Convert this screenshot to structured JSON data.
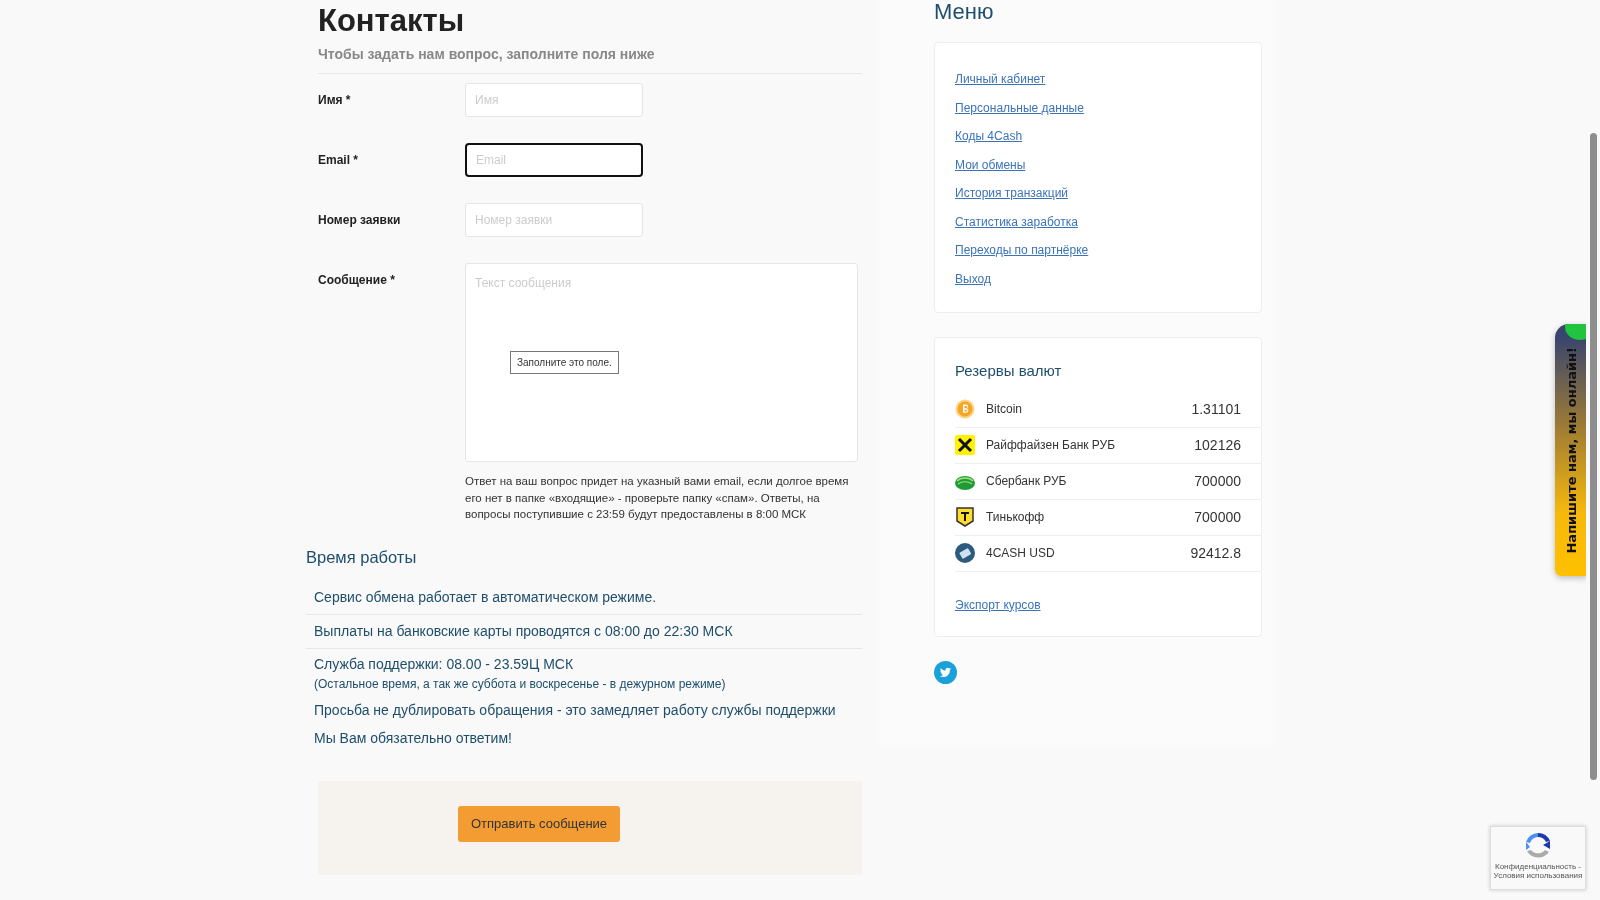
{
  "contact_form": {
    "title": "Контакты",
    "subtitle": "Чтобы задать нам вопрос, заполните поля ниже",
    "fields": [
      {
        "kind": "input",
        "label": "Имя *",
        "placeholder": "Имя",
        "focused": false
      },
      {
        "kind": "input",
        "label": "Email *",
        "placeholder": "Email",
        "focused": true
      },
      {
        "kind": "input",
        "label": "Номер заявки",
        "placeholder": "Номер заявки",
        "focused": false
      },
      {
        "kind": "textarea",
        "label": "Сообщение *",
        "placeholder": "Текст сообщения",
        "focused": false
      }
    ],
    "tooltip": "Заполните это поле.",
    "note": "Ответ на ваш вопрос придет на указный вами email, если долгое время его нет в папке «входящие» - проверьте папку «спам». Ответы, на вопросы поступившие с 23:59 будут предоставлены в 8:00 МСК"
  },
  "working_hours": {
    "title": "Время работы",
    "items": [
      {
        "kind": "row",
        "text": "Сервис обмена работает в автоматическом режиме."
      },
      {
        "kind": "row",
        "text": "Выплаты на банковские карты проводятся с 08:00 до 22:30 МСК"
      },
      {
        "kind": "line",
        "text": "Служба поддержки: 08.00 - 23.59Ц МСК",
        "note": "(Остальное время, а так же суббота и воскресенье - в дежурном режиме)"
      },
      {
        "kind": "line",
        "text": "Просьба не дублировать обращения - это замедляет работу службы поддержки"
      },
      {
        "kind": "line",
        "text": "Мы Вам обязательно ответим!"
      }
    ]
  },
  "submit_button": "Отправить сообщение",
  "menu": {
    "title": "Меню",
    "links": [
      "Личный кабинет",
      "Персональные данные",
      "Коды 4Cash",
      "Мои обмены",
      "История транзакций",
      "Статистика заработка",
      "Переходы по партнёрке",
      "Выход"
    ]
  },
  "reserves": {
    "title": "Резервы валют",
    "rows": [
      {
        "kind": "bitcoin",
        "name": "Bitcoin",
        "amount": "1.31101"
      },
      {
        "kind": "raiffeisen",
        "name": "Райффайзен Банк РУБ",
        "amount": "102126"
      },
      {
        "kind": "sber",
        "name": "Сбербанк РУБ",
        "amount": "700000"
      },
      {
        "kind": "tinkoff",
        "name": "Тинькофф",
        "amount": "700000"
      },
      {
        "kind": "cash",
        "name": "4CASH USD",
        "amount": "92412.8"
      }
    ],
    "export_link": "Экспорт курсов"
  },
  "chat_tab": {
    "label": "Напишите нам, мы онлайн!"
  },
  "recaptcha": {
    "text": "Конфиденциальность - Условия использования"
  }
}
